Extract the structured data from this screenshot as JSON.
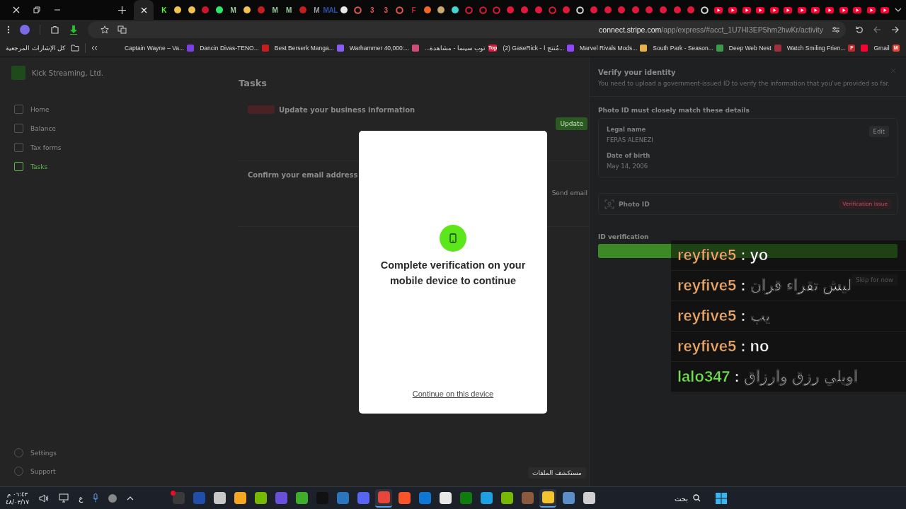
{
  "browser": {
    "tabs": [
      {
        "kind": "letter",
        "glyph": "K",
        "color": "#53fc18"
      },
      {
        "kind": "dot",
        "color": "#f2c14e"
      },
      {
        "kind": "dot",
        "color": "#f2c14e"
      },
      {
        "kind": "dot",
        "color": "#d0142c"
      },
      {
        "kind": "dot",
        "color": "#2ee86b"
      },
      {
        "kind": "letter",
        "glyph": "M",
        "color": "#9ccc9c"
      },
      {
        "kind": "dot",
        "color": "#f2c14e"
      },
      {
        "kind": "dot",
        "color": "#c41e1e"
      },
      {
        "kind": "letter",
        "glyph": "M",
        "color": "#9ccc9c"
      },
      {
        "kind": "letter",
        "glyph": "M",
        "color": "#9ccc9c"
      },
      {
        "kind": "dot",
        "color": "#c41e1e"
      },
      {
        "kind": "letter",
        "glyph": "M",
        "color": "#9e9e9e"
      },
      {
        "kind": "letter",
        "glyph": "MAL",
        "color": "#2e51a2"
      },
      {
        "kind": "dot",
        "color": "#e8e8e8"
      },
      {
        "kind": "ring",
        "color": "#e05a47"
      },
      {
        "kind": "letter",
        "glyph": "3",
        "color": "#e05a47"
      },
      {
        "kind": "letter",
        "glyph": "3",
        "color": "#e05a47"
      },
      {
        "kind": "ring",
        "color": "#e05a47"
      },
      {
        "kind": "letter",
        "glyph": "F",
        "color": "#c4262e"
      },
      {
        "kind": "dot",
        "color": "#f26522"
      },
      {
        "kind": "dot",
        "color": "#c9a96e"
      },
      {
        "kind": "dot",
        "color": "#3dd6d0"
      },
      {
        "kind": "ring",
        "color": "#e0193a"
      },
      {
        "kind": "ring",
        "color": "#e0193a"
      },
      {
        "kind": "ring",
        "color": "#e0193a"
      },
      {
        "kind": "dot",
        "color": "#e0193a"
      },
      {
        "kind": "dot",
        "color": "#e0193a"
      },
      {
        "kind": "dot",
        "color": "#e0193a"
      },
      {
        "kind": "ring",
        "color": "#e0193a"
      },
      {
        "kind": "dot",
        "color": "#e0193a"
      },
      {
        "kind": "ring",
        "color": "#d8d8d8"
      },
      {
        "kind": "dot",
        "color": "#e0193a"
      },
      {
        "kind": "dot",
        "color": "#e0193a"
      },
      {
        "kind": "dot",
        "color": "#e0193a"
      },
      {
        "kind": "dot",
        "color": "#e0193a"
      },
      {
        "kind": "dot",
        "color": "#e0193a"
      },
      {
        "kind": "dot",
        "color": "#e0193a"
      },
      {
        "kind": "dot",
        "color": "#e0193a"
      },
      {
        "kind": "dot",
        "color": "#e0193a"
      },
      {
        "kind": "ring",
        "color": "#d8d8d8"
      },
      {
        "kind": "video",
        "color": "#ff0033"
      },
      {
        "kind": "video",
        "color": "#ff0033"
      },
      {
        "kind": "video",
        "color": "#ff0033"
      },
      {
        "kind": "video",
        "color": "#ff0033"
      },
      {
        "kind": "video",
        "color": "#ff0033"
      },
      {
        "kind": "video",
        "color": "#ff0033"
      },
      {
        "kind": "video",
        "color": "#ff0033"
      },
      {
        "kind": "video",
        "color": "#ff0033"
      },
      {
        "kind": "video",
        "color": "#ff0033"
      },
      {
        "kind": "video",
        "color": "#ff0033"
      },
      {
        "kind": "video",
        "color": "#ff0033"
      },
      {
        "kind": "video",
        "color": "#ff0033"
      },
      {
        "kind": "video",
        "color": "#ff0033"
      }
    ],
    "url": {
      "host": "connect.stripe.com",
      "path": "/app/express/#acct_1U7HI3EP5hm2hwKr/activity"
    },
    "all_bookmarks": "كل الإشارات المرجعية",
    "bookmarks": [
      {
        "label": "Captain Wayne – Va...",
        "color": "#7b3fe4"
      },
      {
        "label": "Dancin Divas-TENO...",
        "color": "#c41e1e"
      },
      {
        "label": "Best Berserk Manga...",
        "color": "#8a5cf6"
      },
      {
        "label": "Warhammer 40,000:...",
        "color": "#d24b7a"
      },
      {
        "label": "توب سينما - مشاهدة...",
        "glyph": "Top",
        "color": "#e0193a"
      },
      {
        "label": "(2) GaseRick - مُتتج ا...",
        "color": "#9146ff"
      },
      {
        "label": "Marvel Rivals Mods...",
        "color": "#e8b04a"
      },
      {
        "label": "South Park - Season...",
        "color": "#3c9a4a"
      },
      {
        "label": "Deep Web Nest",
        "color": "#a0303a"
      },
      {
        "label": "Watch Smiling Frien...",
        "glyph": "F",
        "color": "#c4262e"
      },
      {
        "color": "#ff0033"
      },
      {
        "label": "Gmail",
        "glyph": "M",
        "color": "#ea4335"
      }
    ]
  },
  "sidebar": {
    "company": "Kick Streaming, Ltd.",
    "items": [
      {
        "label": "Home",
        "selected": false
      },
      {
        "label": "Balance",
        "selected": false
      },
      {
        "label": "Tax forms",
        "selected": false
      },
      {
        "label": "Tasks",
        "selected": true
      }
    ],
    "footer": [
      "Settings",
      "Support"
    ]
  },
  "tasks": {
    "title": "Tasks",
    "items": [
      {
        "title": "Update your business information",
        "badge": true,
        "action": "Update",
        "primary": true
      },
      {
        "title": "Confirm your email address",
        "badge": false,
        "action": "Send email",
        "primary": false
      }
    ]
  },
  "modal": {
    "heading": "Complete verification on your mobile device to continue",
    "link": "Continue on this device"
  },
  "panel": {
    "title": "Verify your identity",
    "subtitle": "You need to upload a government-issued ID to verify the information that you've provided so far.",
    "details_heading": "Photo ID must closely match these details",
    "edit": "Edit",
    "fields": [
      {
        "label": "Legal name",
        "value": "FERAS ALENEZI"
      },
      {
        "label": "Date of birth",
        "value": "May 14, 2006"
      }
    ],
    "photo_id": "Photo ID",
    "status": "Verification issue",
    "section": "ID verification",
    "skip": "Skip for now"
  },
  "chat": {
    "separator": ":",
    "messages": [
      {
        "user": "reyfive5",
        "color": "#f0a868",
        "message": "yo"
      },
      {
        "user": "reyfive5",
        "color": "#f0a868",
        "message": "ليش تقراء قران"
      },
      {
        "user": "reyfive5",
        "color": "#f0a868",
        "message": "يب"
      },
      {
        "user": "reyfive5",
        "color": "#f0a868",
        "message": "no"
      },
      {
        "user": "lalo347",
        "color": "#6fe34a",
        "message": "اويلي رزق وارزاق"
      }
    ]
  },
  "tooltip": "مستكشف الملفات",
  "taskbar": {
    "time": "٠٦:٤٣ م",
    "date": "٤٨/٠٣/١٧",
    "language": "ع",
    "search_placeholder": "بحث",
    "apps": [
      {
        "color": "#3a3a3a",
        "active": false,
        "notification": true
      },
      {
        "color": "#1f4fa8",
        "active": false,
        "notification": false
      },
      {
        "color": "#c8c8c8",
        "active": false,
        "notification": false
      },
      {
        "color": "#f5a623",
        "active": false,
        "notification": false
      },
      {
        "color": "#76b900",
        "active": false,
        "notification": false
      },
      {
        "color": "#6a4fd8",
        "active": false,
        "notification": false
      },
      {
        "color": "#3fae2a",
        "active": false,
        "notification": false
      },
      {
        "color": "#111111",
        "active": false,
        "notification": false
      },
      {
        "color": "#2a75bb",
        "active": false,
        "notification": false
      },
      {
        "color": "#5865f2",
        "active": false,
        "notification": false
      },
      {
        "color": "#e8453c",
        "active": true,
        "notification": false
      },
      {
        "color": "#fb542b",
        "active": false,
        "notification": false
      },
      {
        "color": "#0f78d4",
        "active": false,
        "notification": false
      },
      {
        "color": "#e8e8e8",
        "active": false,
        "notification": false
      },
      {
        "color": "#107c10",
        "active": false,
        "notification": false
      },
      {
        "color": "#1fa0e0",
        "active": false,
        "notification": false
      },
      {
        "color": "#76b900",
        "active": false,
        "notification": false
      },
      {
        "color": "#8b5a3c",
        "active": false,
        "notification": false
      },
      {
        "color": "#f4c430",
        "active": true,
        "notification": false
      },
      {
        "color": "#5a8fc8",
        "active": false,
        "notification": false
      },
      {
        "color": "#d0d0d0",
        "active": false,
        "notification": false
      }
    ]
  }
}
